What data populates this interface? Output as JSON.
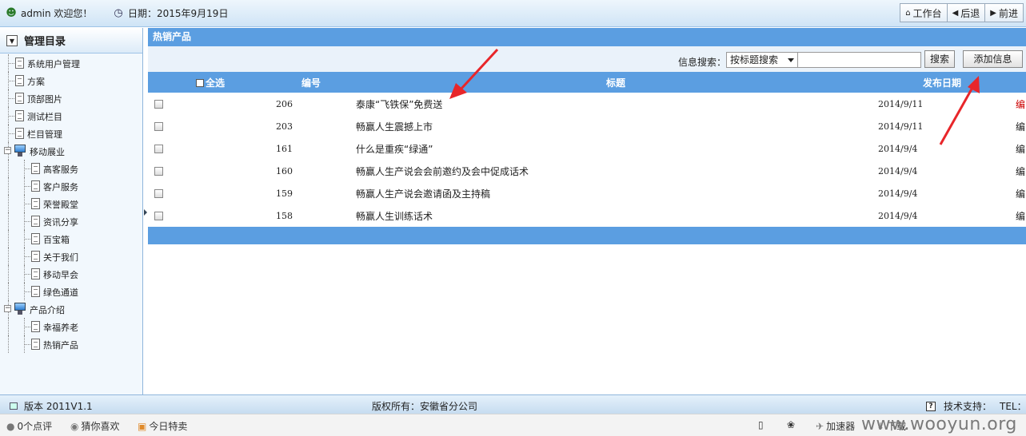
{
  "topbar": {
    "user_text": "admin 欢迎您！",
    "date_text": "日期：2015年9月19日",
    "buttons": {
      "workbench": "工作台",
      "back": "后退",
      "forward": "前进"
    }
  },
  "sidebar": {
    "title": "管理目录",
    "items": [
      "系统用户管理",
      "方案",
      "顶部图片",
      "测试栏目",
      "栏目管理",
      "移动展业",
      "高客服务",
      "客户服务",
      "荣誉殿堂",
      "资讯分享",
      "百宝箱",
      "关于我们",
      "移动早会",
      "绿色通道",
      "产品介绍",
      "幸福养老",
      "热销产品"
    ]
  },
  "main": {
    "title": "热销产品",
    "search": {
      "label": "信息搜索：",
      "select_value": "按标题搜索",
      "input_value": "",
      "search_btn": "搜索",
      "add_btn": "添加信息"
    },
    "table": {
      "headers": {
        "select_all": "全选",
        "id": "编号",
        "title": "标题",
        "date": "发布日期"
      },
      "rows": [
        {
          "id": "206",
          "title": "泰康“飞铁保”免费送",
          "date": "2014/9/11",
          "action": "编"
        },
        {
          "id": "203",
          "title": "畅赢人生震撼上市",
          "date": "2014/9/11",
          "action": "编"
        },
        {
          "id": "161",
          "title": "什么是重疾“绿通”",
          "date": "2014/9/4",
          "action": "编"
        },
        {
          "id": "160",
          "title": "畅赢人生产说会会前邀约及会中促成话术",
          "date": "2014/9/4",
          "action": "编"
        },
        {
          "id": "159",
          "title": "畅赢人生产说会邀请函及主持稿",
          "date": "2014/9/4",
          "action": "编"
        },
        {
          "id": "158",
          "title": "畅赢人生训练话术",
          "date": "2014/9/4",
          "action": "编"
        }
      ]
    }
  },
  "footer": {
    "version": "版本 2011V1.1",
    "copyright": "版权所有：安徽省分公司",
    "tech": "技术支持：",
    "tel": "TEL："
  },
  "statusbar": {
    "comments": "0个点评",
    "guess": "猜你喜欢",
    "deals": "今日特卖",
    "accelerator": "加速器",
    "download": "下载",
    "watermark": "www.wooyun.org"
  },
  "colors": {
    "header_blue": "#5b9ee1",
    "arrow_red": "#e8262a"
  }
}
